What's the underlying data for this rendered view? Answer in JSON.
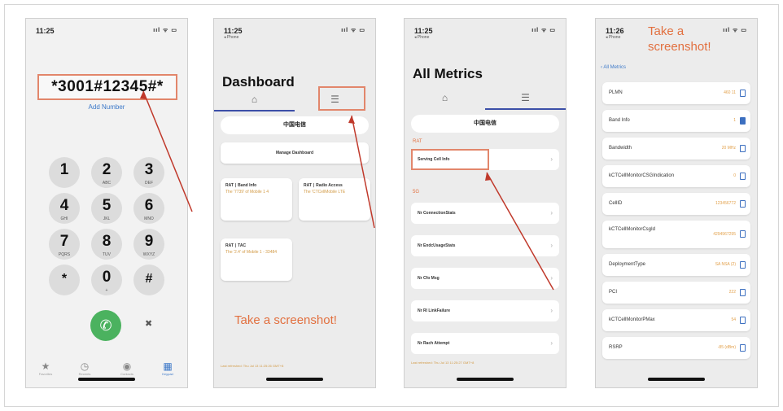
{
  "phone1": {
    "time": "11:25",
    "signal": "ııl ᯤ ▭",
    "dial_number": "*3001#12345#*",
    "add_number": "Add Number",
    "keys": [
      {
        "digit": "1",
        "letters": ""
      },
      {
        "digit": "2",
        "letters": "ABC"
      },
      {
        "digit": "3",
        "letters": "DEF"
      },
      {
        "digit": "4",
        "letters": "GHI"
      },
      {
        "digit": "5",
        "letters": "JKL"
      },
      {
        "digit": "6",
        "letters": "MNO"
      },
      {
        "digit": "7",
        "letters": "PQRS"
      },
      {
        "digit": "8",
        "letters": "TUV"
      },
      {
        "digit": "9",
        "letters": "WXYZ"
      },
      {
        "digit": "*",
        "letters": ""
      },
      {
        "digit": "0",
        "letters": "+"
      },
      {
        "digit": "#",
        "letters": ""
      }
    ],
    "call_icon": "✆",
    "delete_icon": "✖",
    "tabs": [
      {
        "icon": "★",
        "label": "Favorites"
      },
      {
        "icon": "◷",
        "label": "Recents"
      },
      {
        "icon": "◉",
        "label": "Contacts"
      },
      {
        "icon": "▦",
        "label": "Keypad"
      }
    ]
  },
  "phone2": {
    "time": "11:25",
    "sub": "◂ Phone",
    "signal": "ııl ᯤ ▭",
    "title": "Dashboard",
    "tab_home_icon": "⌂",
    "tab_list_icon": "☰",
    "carrier": "中国电信",
    "manage": "Manage Dashboard",
    "cards": [
      {
        "title": "RAT ∣ Band Info",
        "sub": "The '7739' of Mobile 1 4"
      },
      {
        "title": "RAT ∣ Radio Access",
        "sub": "The 'CTCellMobile LTE"
      },
      {
        "title": "RAT ∣ TAC",
        "sub": "The '2.4' of Mobile 1 - 33484"
      }
    ],
    "screenshot_text": "Take a screenshot!",
    "footer": "Last refreshed: Thu Jul 13 11:25:26 GMT+8"
  },
  "phone3": {
    "time": "11:25",
    "sub": "◂ Phone",
    "signal": "ııl ᯤ ▭",
    "title": "All Metrics",
    "tab_home_icon": "⌂",
    "tab_list_icon": "☰",
    "carrier": "中国电信",
    "section_rat": "RAT",
    "section_5g": "5G",
    "rows": [
      "Serving Cell Info",
      "Nr ConnectionStats",
      "Nr EndcUsageStats",
      "Nr Cfo Msg",
      "Nr Rl LinkFailure",
      "Nr Rach Attempt"
    ],
    "chevron": "›",
    "footer": "Last refreshed: Thu Jul 13 11:25:27 GMT+8"
  },
  "phone4": {
    "time": "11:26",
    "sub": "◂ Phone",
    "signal": "ııl ᯤ ▭",
    "back": "‹ All Metrics",
    "screenshot_line1": "Take a",
    "screenshot_line2": "screenshot!",
    "metrics": [
      {
        "name": "PLMN",
        "value": "460 11",
        "filled": false
      },
      {
        "name": "Band Info",
        "value": "1",
        "filled": true
      },
      {
        "name": "Bandwidth",
        "value": "20 MHz",
        "filled": false
      },
      {
        "name": "kCTCellMonitorCSGIndication",
        "value": "0",
        "filled": false
      },
      {
        "name": "CellID",
        "value": "123456772",
        "filled": false
      },
      {
        "name": "kCTCellMonitorCsgId",
        "value": "4294967295",
        "filled": false
      },
      {
        "name": "DeploymentType",
        "value": "SA NSA (2)",
        "filled": false
      },
      {
        "name": "PCI",
        "value": "222",
        "filled": false
      },
      {
        "name": "kCTCellMonitorPMax",
        "value": "54",
        "filled": false
      },
      {
        "name": "RSRP",
        "value": "-85 (dBm)",
        "filled": false
      }
    ]
  },
  "colors": {
    "highlight": "#e2866b",
    "arrow": "#c0392b",
    "accent_blue": "#3c78c8",
    "orange_text": "#e2703f",
    "call_green": "#4bb25f"
  }
}
